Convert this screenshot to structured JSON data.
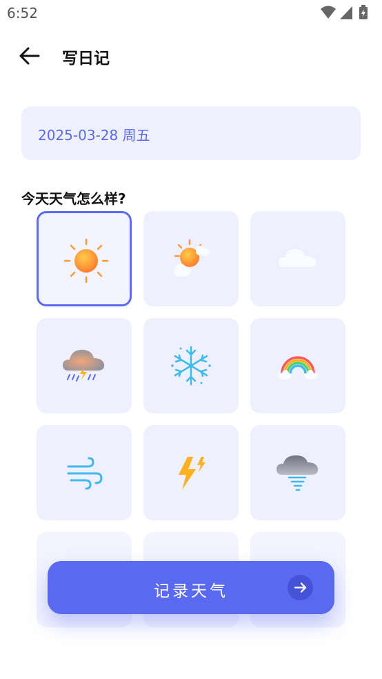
{
  "status": {
    "time": "6:52"
  },
  "header": {
    "title": "写日记",
    "back_icon": "arrow-left-icon"
  },
  "date": {
    "value": "2025-03-28 周五"
  },
  "weather_section": {
    "question": "今天天气怎么样?",
    "options": [
      {
        "icon": "sun-icon",
        "selected": true
      },
      {
        "icon": "partly-cloudy-icon",
        "selected": false
      },
      {
        "icon": "cloud-icon",
        "selected": false
      },
      {
        "icon": "thunderstorm-rain-icon",
        "selected": false
      },
      {
        "icon": "snowflake-icon",
        "selected": false
      },
      {
        "icon": "rainbow-icon",
        "selected": false
      },
      {
        "icon": "wind-icon",
        "selected": false
      },
      {
        "icon": "lightning-icon",
        "selected": false
      },
      {
        "icon": "tornado-icon",
        "selected": false
      }
    ]
  },
  "action": {
    "record_label": "记录天气",
    "icon": "arrow-right-icon"
  },
  "colors": {
    "accent": "#5a6af0",
    "tile_bg": "#eef0fd",
    "sun": "#ff9a3c",
    "ice": "#3fb9ee"
  }
}
